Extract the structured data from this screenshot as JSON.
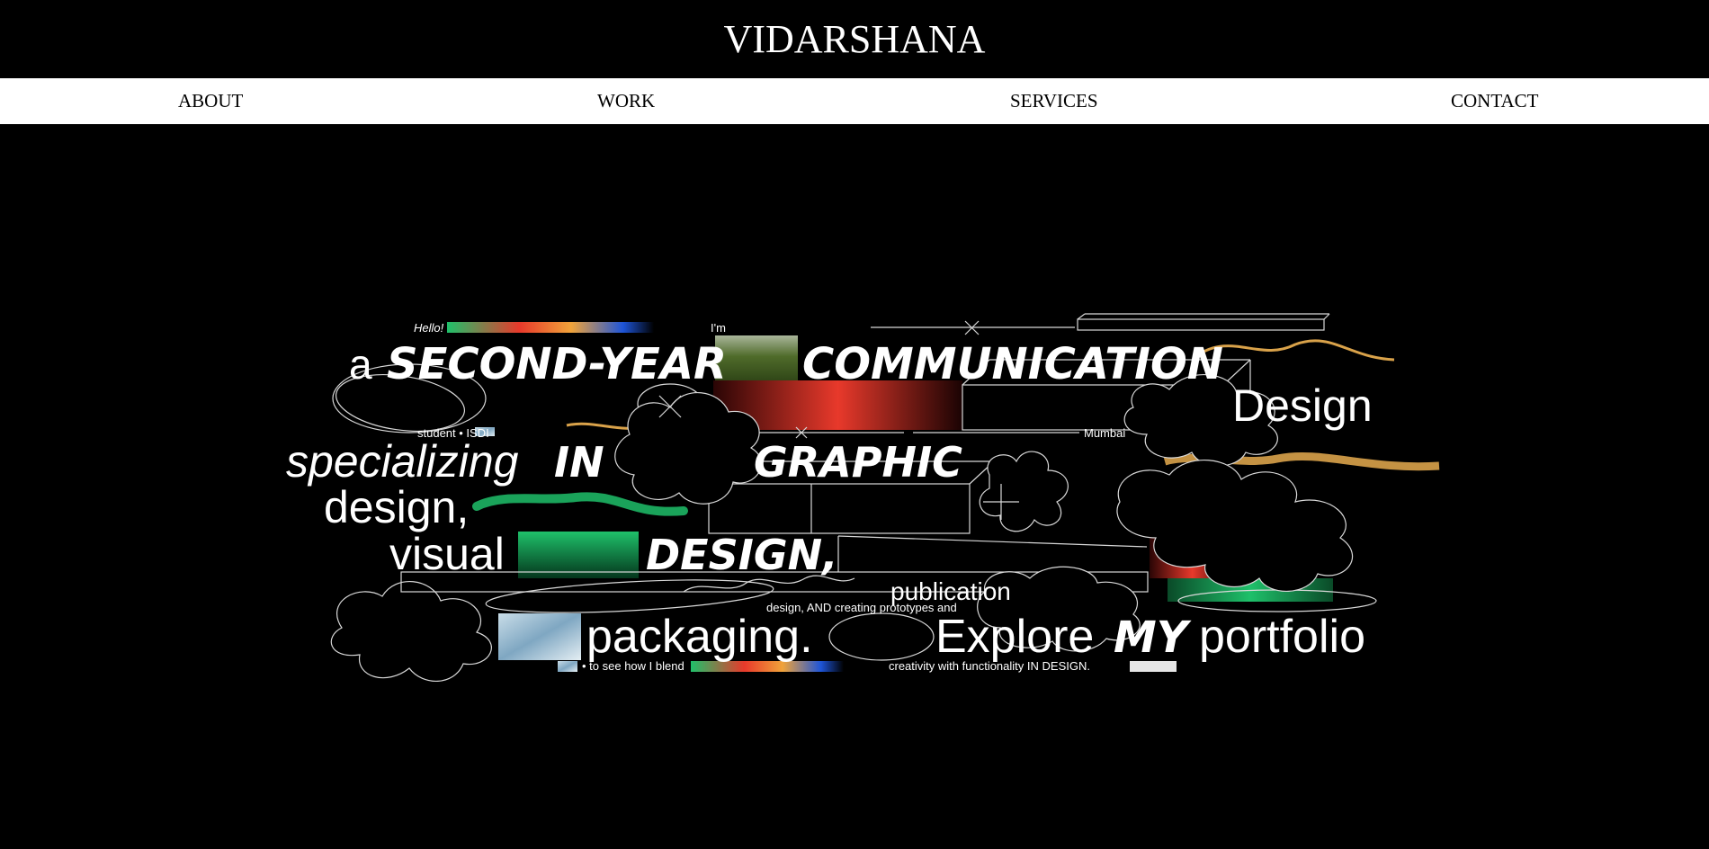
{
  "header": {
    "title": "VIDARSHANA"
  },
  "nav": {
    "items": [
      {
        "label": "ABOUT"
      },
      {
        "label": "WORK"
      },
      {
        "label": "SERVICES"
      },
      {
        "label": "CONTACT"
      }
    ]
  },
  "hero": {
    "hello": "Hello!",
    "im": "I'm",
    "a": "a",
    "second_year": "SECOND-YEAR",
    "communication": "COMMUNICATION",
    "design_word": "Design",
    "student_line": "student • ISDI",
    "mumbai": "Mumbai",
    "specializing": "specializing",
    "in_word": "IN",
    "graphic": "GRAPHIC",
    "design_comma": "design,",
    "visual": "visual",
    "design_caps": "DESIGN,",
    "publication": "publication",
    "small_line_1": "design, AND creating prototypes and",
    "packaging": "packaging.",
    "explore": "Explore",
    "my": "MY",
    "portfolio": "portfolio",
    "small_line_2": "• to see how I blend",
    "small_line_3": "creativity with functionality IN DESIGN.",
    "colors": {
      "red": "#e8392b",
      "green": "#1fc06a",
      "orange": "#f0a33a",
      "blue": "#1e55d8",
      "gold": "#d9a24a"
    }
  }
}
